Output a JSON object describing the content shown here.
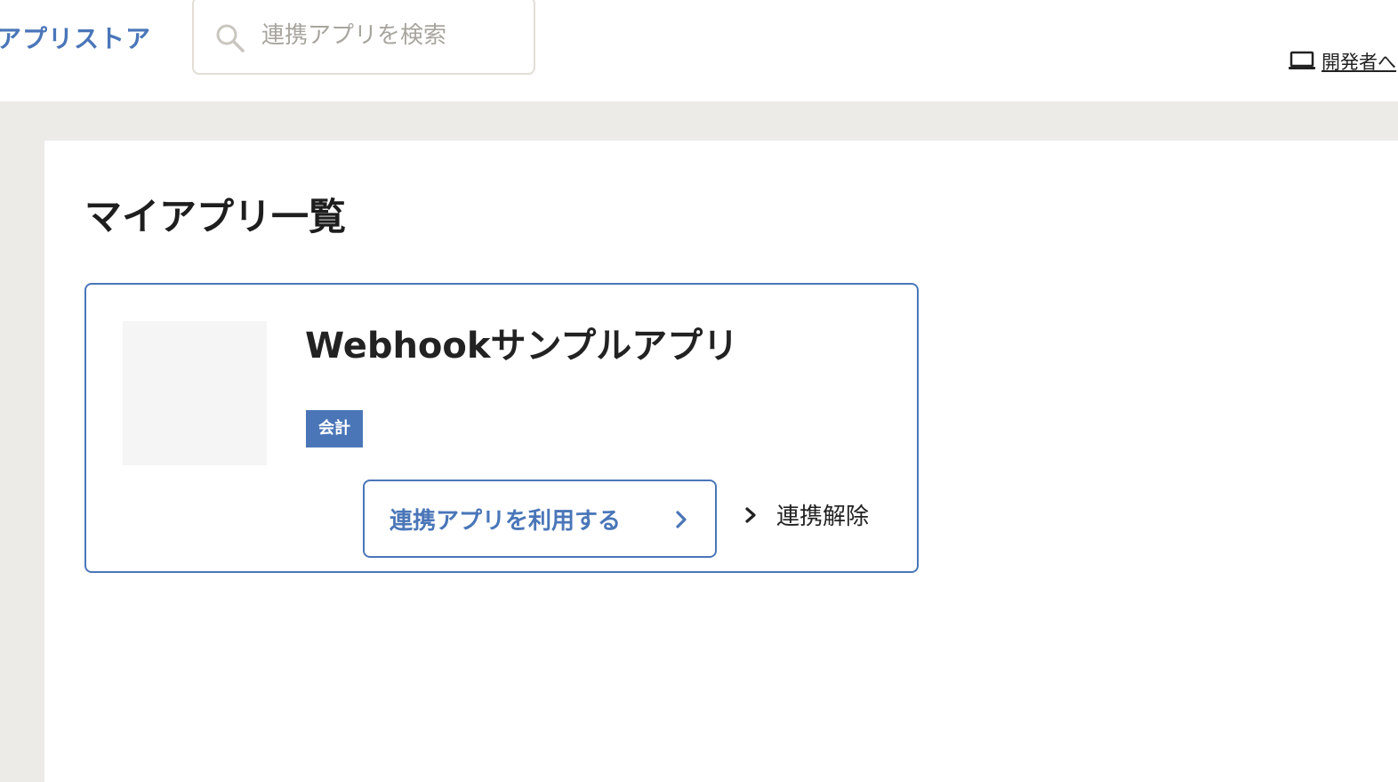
{
  "header": {
    "brand": "アプリストア",
    "search": {
      "placeholder": "連携アプリを検索",
      "icon": "search-icon"
    },
    "developer_link": {
      "label": "開発者へ",
      "icon": "laptop-icon"
    }
  },
  "main": {
    "title": "マイアプリ一覧",
    "apps": [
      {
        "name": "Webhookサンプルアプリ",
        "category": "会計",
        "use_button": "連携アプリを利用する",
        "unlink_label": "連携解除"
      }
    ]
  },
  "colors": {
    "accent": "#4a76b8",
    "page_bg": "#edebe7",
    "thumb_bg": "#f5f5f5"
  }
}
